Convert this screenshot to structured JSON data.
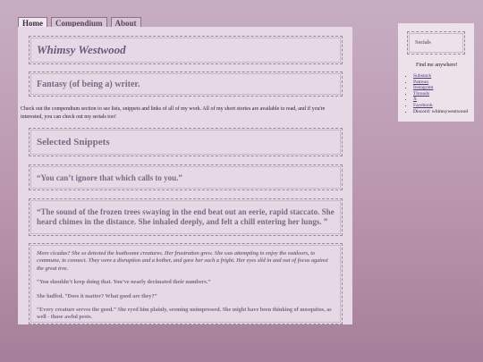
{
  "tabs": [
    {
      "label": "Home",
      "active": true
    },
    {
      "label": "Compendium",
      "active": false
    },
    {
      "label": "About",
      "active": false
    }
  ],
  "main": {
    "title": "Whimsy Westwood",
    "subtitle": "Fantasy (of being a) writer.",
    "intro": "Check out the compendium section to see lists, snippets and links of all of my work. All of my short stories are available to read, and if you're interested, you can check out my serials too!",
    "section_title": "Selected Snippets",
    "quote1": "“You can’t ignore that which calls to you.”",
    "quote2": "“The sound of the frozen trees swaying in the end beat out an eerie, rapid staccato. She heard chimes in the distance. She inhaled deeply, and felt a chill entering her lungs. ”",
    "story": [
      "More cicadas? She so detested the loathsome creatures. Her frustration grew. She was attempting to enjoy the outdoors, to commune, to connect. They were a disruption and a bother, and gave her such a fright. Her eyes slid in and out of focus against the great tree.",
      "“You shouldn’t keep doing that. You’ve nearly decimated their numbers.”",
      "She huffed. “Does it matter? What good are they?”",
      "“Every creature serves the good.” She eyed him plainly, seeming unimpressed. She might have been thinking of mosquitos, as well - those awful pests."
    ]
  },
  "sidebar": {
    "heading": "Socials",
    "find_text": "Find me anywhere!",
    "links": [
      "Substack",
      "Patreon",
      "Instagram",
      "Threads",
      "X",
      "Facebook"
    ],
    "discord": "Discord: whimsywestwood"
  }
}
